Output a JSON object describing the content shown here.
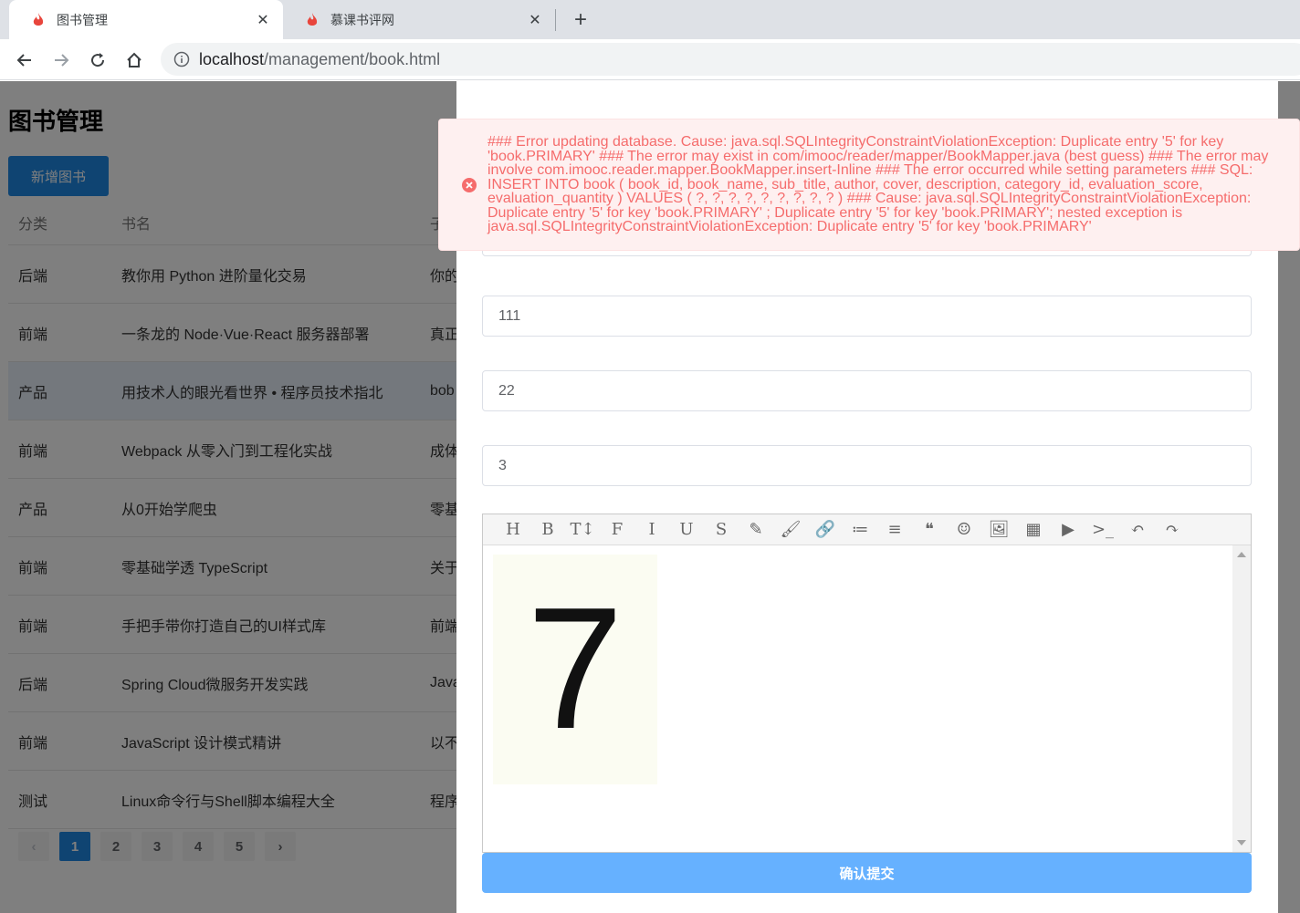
{
  "browser": {
    "tabs": [
      {
        "title": "图书管理",
        "active": true
      },
      {
        "title": "慕课书评网",
        "active": false
      }
    ],
    "url_host": "localhost",
    "url_path": "/management/book.html"
  },
  "page": {
    "title": "图书管理",
    "add_button": "新增图书",
    "columns": [
      "分类",
      "书名",
      "子"
    ],
    "rows": [
      {
        "category": "后端",
        "name": "教你用 Python 进阶量化交易",
        "sub": "你的"
      },
      {
        "category": "前端",
        "name": "一条龙的 Node·Vue·React 服务器部署",
        "sub": "真正"
      },
      {
        "category": "产品",
        "name": "用技术人的眼光看世界 • 程序员技术指北",
        "sub": "bob"
      },
      {
        "category": "前端",
        "name": "Webpack 从零入门到工程化实战",
        "sub": "成体"
      },
      {
        "category": "产品",
        "name": "从0开始学爬虫",
        "sub": "零基"
      },
      {
        "category": "前端",
        "name": "零基础学透 TypeScript",
        "sub": "关于"
      },
      {
        "category": "前端",
        "name": "手把手带你打造自己的UI样式库",
        "sub": "前端"
      },
      {
        "category": "后端",
        "name": "Spring Cloud微服务开发实践",
        "sub": "Java"
      },
      {
        "category": "前端",
        "name": "JavaScript 设计模式精讲",
        "sub": "以不"
      },
      {
        "category": "测试",
        "name": "Linux命令行与Shell脚本编程大全",
        "sub": "程序"
      }
    ],
    "pagination": {
      "prev": "‹",
      "next": "›",
      "pages": [
        "1",
        "2",
        "3",
        "4",
        "5"
      ],
      "current": "1"
    }
  },
  "drawer": {
    "field_values": [
      "111",
      "22",
      "3"
    ],
    "editor_toolbar": [
      "H",
      "B",
      "T↕",
      "F",
      "I",
      "U",
      "S",
      "✎",
      "🖌",
      "🔗",
      "≔",
      "≡",
      "❝",
      "☺",
      "🖼",
      "▦",
      "▶",
      ">_",
      "↶",
      "↷"
    ],
    "editor_image_text": "7",
    "submit_label": "确认提交"
  },
  "error": {
    "message": "### Error updating database. Cause: java.sql.SQLIntegrityConstraintViolationException: Duplicate entry '5' for key 'book.PRIMARY' ### The error may exist in com/imooc/reader/mapper/BookMapper.java (best guess) ### The error may involve com.imooc.reader.mapper.BookMapper.insert-Inline ### The error occurred while setting parameters ### SQL: INSERT INTO book ( book_id, book_name, sub_title, author, cover, description, category_id, evaluation_score, evaluation_quantity ) VALUES ( ?, ?, ?, ?, ?, ?, ?, ?, ? ) ### Cause: java.sql.SQLIntegrityConstraintViolationException: Duplicate entry '5' for key 'book.PRIMARY' ; Duplicate entry '5' for key 'book.PRIMARY'; nested exception is java.sql.SQLIntegrityConstraintViolationException: Duplicate entry '5' for key 'book.PRIMARY'",
    "color": "#f56c6c"
  }
}
